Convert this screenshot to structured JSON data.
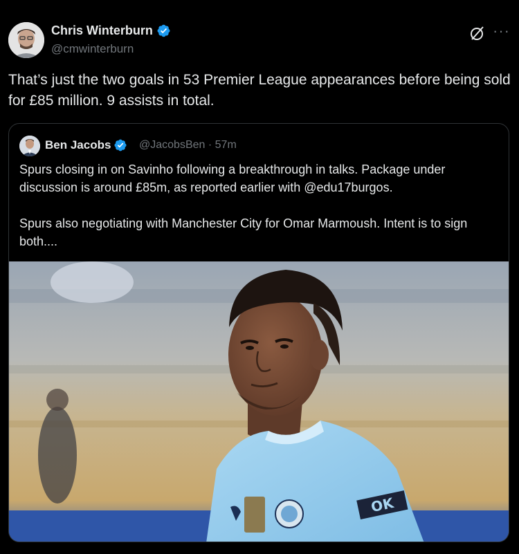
{
  "tweet": {
    "author_name": "Chris Winterburn",
    "author_handle": "@cmwinterburn",
    "text": "That’s just the two goals in 53 Premier League appearances before being sold for £85 million. 9 assists in total.",
    "icons": [
      "grok-icon",
      "more-icon",
      "verified-icon"
    ],
    "more_label": "···"
  },
  "quote": {
    "author_name": "Ben Jacobs",
    "author_handle": "@JacobsBen",
    "separator": "·",
    "time": "57m",
    "text": "Spurs closing in on Savinho following a breakthrough in talks. Package under discussion is around £85m, as reported earlier with @edu17burgos.\n\nSpurs also negotiating with Manchester City for Omar Marmoush. Intent is to sign both....",
    "photo": {
      "description_icon": "player-photo",
      "shirt_sponsor": "OK"
    }
  },
  "colors": {
    "background": "#000000",
    "text": "#e7e9ea",
    "secondary": "#71767b",
    "verified": "#1d9bf0",
    "border": "#2f3336",
    "shirt": "#9fd0ef"
  }
}
